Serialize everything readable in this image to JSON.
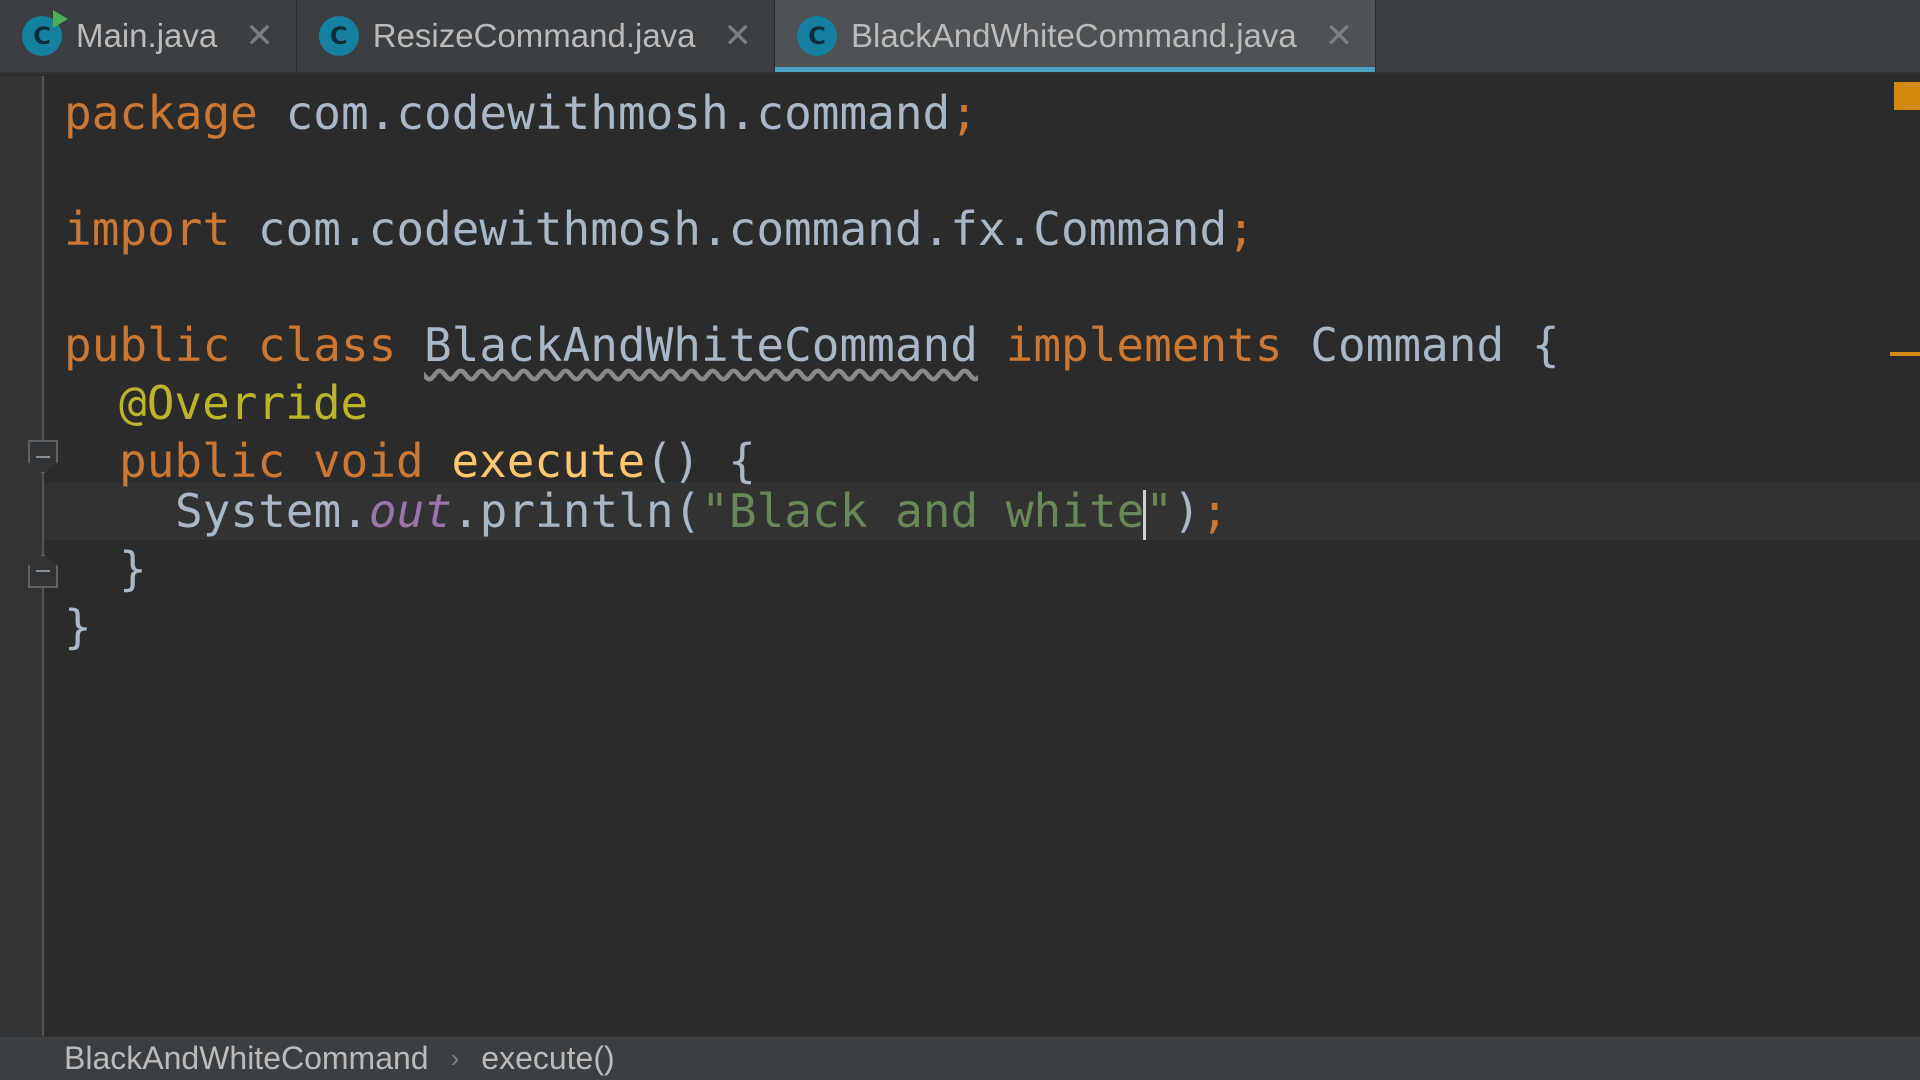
{
  "tabs": [
    {
      "label": "Main.java",
      "icon": "class-run-icon",
      "active": false
    },
    {
      "label": "ResizeCommand.java",
      "icon": "class-icon",
      "active": false
    },
    {
      "label": "BlackAndWhiteCommand.java",
      "icon": "class-icon",
      "active": true
    }
  ],
  "tab_icon_letter": "C",
  "tab_close_glyph": "✕",
  "code": {
    "line1": {
      "kw": "package",
      "rest": " com.codewithmosh.command",
      "semi": ";"
    },
    "line3": {
      "kw": "import",
      "rest": " com.codewithmosh.command.fx.Command",
      "semi": ";"
    },
    "line5": {
      "kw1": "public",
      "kw2": " class ",
      "classname": "BlackAndWhiteCommand",
      "kw3": " implements",
      "iface": " Command {"
    },
    "line6": {
      "annotation": "@Override"
    },
    "line7": {
      "kw1": "public",
      "kw2": " void ",
      "method": "execute",
      "rest": "() {"
    },
    "line8": {
      "obj": "System.",
      "field": "out",
      "call": ".println(",
      "str_before_cursor": "\"Black and white",
      "str_after_cursor": "\"",
      "close": ")",
      "semi": ";"
    },
    "line9": {
      "brace": "}"
    },
    "line10": {
      "brace": "}"
    }
  },
  "breadcrumb": {
    "class": "BlackAndWhiteCommand",
    "separator": "›",
    "method": "execute()"
  },
  "colors": {
    "background": "#2b2b2b",
    "keyword": "#cc7832",
    "annotation": "#bbb529",
    "function": "#ffc66d",
    "string": "#6a8759",
    "field": "#9876aa",
    "text": "#a9b7c6",
    "tab_accent": "#4a9fc3",
    "class_icon": "#16809f"
  }
}
